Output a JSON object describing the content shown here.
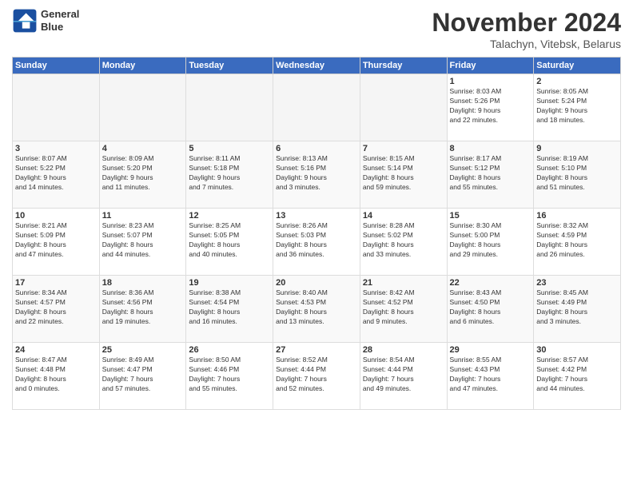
{
  "header": {
    "logo_line1": "General",
    "logo_line2": "Blue",
    "month": "November 2024",
    "location": "Talachyn, Vitebsk, Belarus"
  },
  "weekdays": [
    "Sunday",
    "Monday",
    "Tuesday",
    "Wednesday",
    "Thursday",
    "Friday",
    "Saturday"
  ],
  "weeks": [
    [
      {
        "day": "",
        "info": ""
      },
      {
        "day": "",
        "info": ""
      },
      {
        "day": "",
        "info": ""
      },
      {
        "day": "",
        "info": ""
      },
      {
        "day": "",
        "info": ""
      },
      {
        "day": "1",
        "info": "Sunrise: 8:03 AM\nSunset: 5:26 PM\nDaylight: 9 hours\nand 22 minutes."
      },
      {
        "day": "2",
        "info": "Sunrise: 8:05 AM\nSunset: 5:24 PM\nDaylight: 9 hours\nand 18 minutes."
      }
    ],
    [
      {
        "day": "3",
        "info": "Sunrise: 8:07 AM\nSunset: 5:22 PM\nDaylight: 9 hours\nand 14 minutes."
      },
      {
        "day": "4",
        "info": "Sunrise: 8:09 AM\nSunset: 5:20 PM\nDaylight: 9 hours\nand 11 minutes."
      },
      {
        "day": "5",
        "info": "Sunrise: 8:11 AM\nSunset: 5:18 PM\nDaylight: 9 hours\nand 7 minutes."
      },
      {
        "day": "6",
        "info": "Sunrise: 8:13 AM\nSunset: 5:16 PM\nDaylight: 9 hours\nand 3 minutes."
      },
      {
        "day": "7",
        "info": "Sunrise: 8:15 AM\nSunset: 5:14 PM\nDaylight: 8 hours\nand 59 minutes."
      },
      {
        "day": "8",
        "info": "Sunrise: 8:17 AM\nSunset: 5:12 PM\nDaylight: 8 hours\nand 55 minutes."
      },
      {
        "day": "9",
        "info": "Sunrise: 8:19 AM\nSunset: 5:10 PM\nDaylight: 8 hours\nand 51 minutes."
      }
    ],
    [
      {
        "day": "10",
        "info": "Sunrise: 8:21 AM\nSunset: 5:09 PM\nDaylight: 8 hours\nand 47 minutes."
      },
      {
        "day": "11",
        "info": "Sunrise: 8:23 AM\nSunset: 5:07 PM\nDaylight: 8 hours\nand 44 minutes."
      },
      {
        "day": "12",
        "info": "Sunrise: 8:25 AM\nSunset: 5:05 PM\nDaylight: 8 hours\nand 40 minutes."
      },
      {
        "day": "13",
        "info": "Sunrise: 8:26 AM\nSunset: 5:03 PM\nDaylight: 8 hours\nand 36 minutes."
      },
      {
        "day": "14",
        "info": "Sunrise: 8:28 AM\nSunset: 5:02 PM\nDaylight: 8 hours\nand 33 minutes."
      },
      {
        "day": "15",
        "info": "Sunrise: 8:30 AM\nSunset: 5:00 PM\nDaylight: 8 hours\nand 29 minutes."
      },
      {
        "day": "16",
        "info": "Sunrise: 8:32 AM\nSunset: 4:59 PM\nDaylight: 8 hours\nand 26 minutes."
      }
    ],
    [
      {
        "day": "17",
        "info": "Sunrise: 8:34 AM\nSunset: 4:57 PM\nDaylight: 8 hours\nand 22 minutes."
      },
      {
        "day": "18",
        "info": "Sunrise: 8:36 AM\nSunset: 4:56 PM\nDaylight: 8 hours\nand 19 minutes."
      },
      {
        "day": "19",
        "info": "Sunrise: 8:38 AM\nSunset: 4:54 PM\nDaylight: 8 hours\nand 16 minutes."
      },
      {
        "day": "20",
        "info": "Sunrise: 8:40 AM\nSunset: 4:53 PM\nDaylight: 8 hours\nand 13 minutes."
      },
      {
        "day": "21",
        "info": "Sunrise: 8:42 AM\nSunset: 4:52 PM\nDaylight: 8 hours\nand 9 minutes."
      },
      {
        "day": "22",
        "info": "Sunrise: 8:43 AM\nSunset: 4:50 PM\nDaylight: 8 hours\nand 6 minutes."
      },
      {
        "day": "23",
        "info": "Sunrise: 8:45 AM\nSunset: 4:49 PM\nDaylight: 8 hours\nand 3 minutes."
      }
    ],
    [
      {
        "day": "24",
        "info": "Sunrise: 8:47 AM\nSunset: 4:48 PM\nDaylight: 8 hours\nand 0 minutes."
      },
      {
        "day": "25",
        "info": "Sunrise: 8:49 AM\nSunset: 4:47 PM\nDaylight: 7 hours\nand 57 minutes."
      },
      {
        "day": "26",
        "info": "Sunrise: 8:50 AM\nSunset: 4:46 PM\nDaylight: 7 hours\nand 55 minutes."
      },
      {
        "day": "27",
        "info": "Sunrise: 8:52 AM\nSunset: 4:44 PM\nDaylight: 7 hours\nand 52 minutes."
      },
      {
        "day": "28",
        "info": "Sunrise: 8:54 AM\nSunset: 4:44 PM\nDaylight: 7 hours\nand 49 minutes."
      },
      {
        "day": "29",
        "info": "Sunrise: 8:55 AM\nSunset: 4:43 PM\nDaylight: 7 hours\nand 47 minutes."
      },
      {
        "day": "30",
        "info": "Sunrise: 8:57 AM\nSunset: 4:42 PM\nDaylight: 7 hours\nand 44 minutes."
      }
    ]
  ]
}
